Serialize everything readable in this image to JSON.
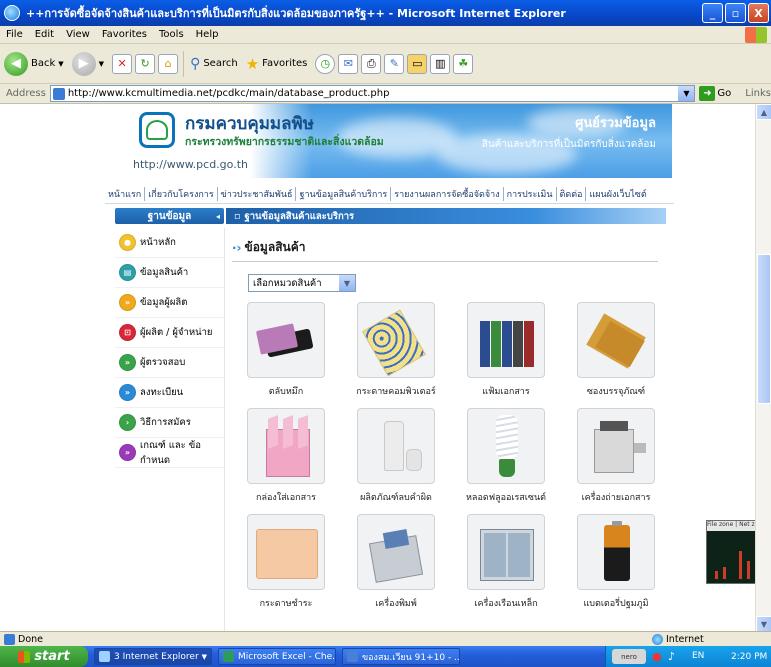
{
  "window": {
    "title": "++การจัดซื้อจัดจ้างสินค้าและบริการที่เป็นมิตรกับสิ่งแวดล้อมของภาครัฐ++ - Microsoft Internet Explorer",
    "buttons": [
      "_",
      "▫",
      "X"
    ]
  },
  "menu": [
    "File",
    "Edit",
    "View",
    "Favorites",
    "Tools",
    "Help"
  ],
  "toolbar": {
    "back": "Back",
    "search": "Search",
    "favorites": "Favorites"
  },
  "address": {
    "label": "Address",
    "url": "http://www.kcmultimedia.net/pcdkc/main/database_product.php",
    "go": "Go",
    "links": "Links"
  },
  "banner": {
    "dept_name": "กรมควบคุมมลพิษ",
    "ministry": "กระทรวงทรัพยากรธรรมชาติและสิ่งแวดล้อม",
    "url": "http://www.pcd.go.th",
    "center_title": "ศูนย์รวมข้อมูล",
    "center_subtitle": "สินค้าและบริการที่เป็นมิตรกับสิ่งแวดล้อม"
  },
  "nav": [
    "หน้าแรก",
    "เกี่ยวกับโครงการ",
    "ข่าวประชาสัมพันธ์",
    "ฐานข้อมูลสินค้าบริการ",
    "รายงานผลการจัดซื้อจัดจ้าง",
    "การประเมิน",
    "ติดต่อ",
    "แผนผังเว็บไซต์"
  ],
  "section": {
    "left": "ฐานข้อมูล",
    "right": "ฐานข้อมูลสินค้าและบริการ"
  },
  "sidebar": [
    {
      "label": "หน้าหลัก",
      "color": "#f2c12e"
    },
    {
      "label": "ข้อมูลสินค้า",
      "color": "#2d9fa8"
    },
    {
      "label": "ข้อมูลผู้ผลิต",
      "color": "#f0a81c"
    },
    {
      "label": "ผู้ผลิต / ผู้จำหน่าย",
      "color": "#d8273a"
    },
    {
      "label": "ผู้ตรวจสอบ",
      "color": "#3aa34a"
    },
    {
      "label": "ลงทะเบียน",
      "color": "#2b8ad6"
    },
    {
      "label": "วิธีการสมัคร",
      "color": "#3aa34a"
    },
    {
      "label": "เกณฑ์ และ ข้อกำหนด",
      "color": "#9a3ab8"
    }
  ],
  "content": {
    "title": "ข้อมูลสินค้า",
    "select_value": "เลือกหมวดสินค้า"
  },
  "products": [
    {
      "label": "ตลับหมึก",
      "icon": "toner-cartridge"
    },
    {
      "label": "กระดาษคอมพิวเตอร์",
      "icon": "computer-paper"
    },
    {
      "label": "แฟ้มเอกสาร",
      "icon": "document-folders"
    },
    {
      "label": "ซองบรรจุภัณฑ์",
      "icon": "envelopes"
    },
    {
      "label": "กล่องใส่เอกสาร",
      "icon": "document-box"
    },
    {
      "label": "ผลิตภัณฑ์ลบคำผิด",
      "icon": "correction-fluid"
    },
    {
      "label": "หลอดฟลูออเรสเซนต์",
      "icon": "fluorescent-bulb"
    },
    {
      "label": "เครื่องถ่ายเอกสาร",
      "icon": "photocopier"
    },
    {
      "label": "กระดาษชำระ",
      "icon": "toilet-paper"
    },
    {
      "label": "เครื่องพิมพ์",
      "icon": "printer"
    },
    {
      "label": "เครื่องเรือนเหล็ก",
      "icon": "steel-cabinet"
    },
    {
      "label": "แบตเตอรี่ปฐมภูมิ",
      "icon": "battery"
    }
  ],
  "widget": {
    "header": "File zone | Net zone"
  },
  "status": {
    "left": "Done",
    "zone": "Internet"
  },
  "taskbar": {
    "start": "start",
    "tasks": [
      "3 Internet Explorer",
      "Microsoft Excel - Che...",
      "ของสม.เวียน 91+10 - ..."
    ],
    "lang": "EN",
    "nero": "nero",
    "clock": "2:20 PM"
  }
}
